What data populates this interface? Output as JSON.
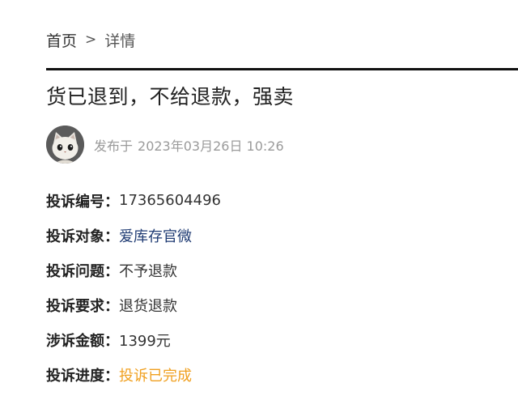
{
  "breadcrumb": {
    "home": "首页",
    "separator": ">",
    "current": "详情"
  },
  "title": "货已退到，不给退款，强卖",
  "meta": {
    "published_label": "发布于",
    "published_time": "2023年03月26日 10:26",
    "avatar_icon": "cat-avatar-icon"
  },
  "complaint": {
    "number": {
      "label": "投诉编号：",
      "value": "17365604496"
    },
    "target": {
      "label": "投诉对象：",
      "value": "爱库存官微"
    },
    "issue": {
      "label": "投诉问题：",
      "value": "不予退款"
    },
    "request": {
      "label": "投诉要求：",
      "value": "退货退款"
    },
    "amount": {
      "label": "涉诉金额：",
      "value": "1399元"
    },
    "progress": {
      "label": "投诉进度：",
      "value": "投诉已完成"
    }
  },
  "colors": {
    "link": "#1f3b73",
    "status_done": "#f0a020",
    "muted": "#9a9a9a",
    "divider": "#111111"
  }
}
